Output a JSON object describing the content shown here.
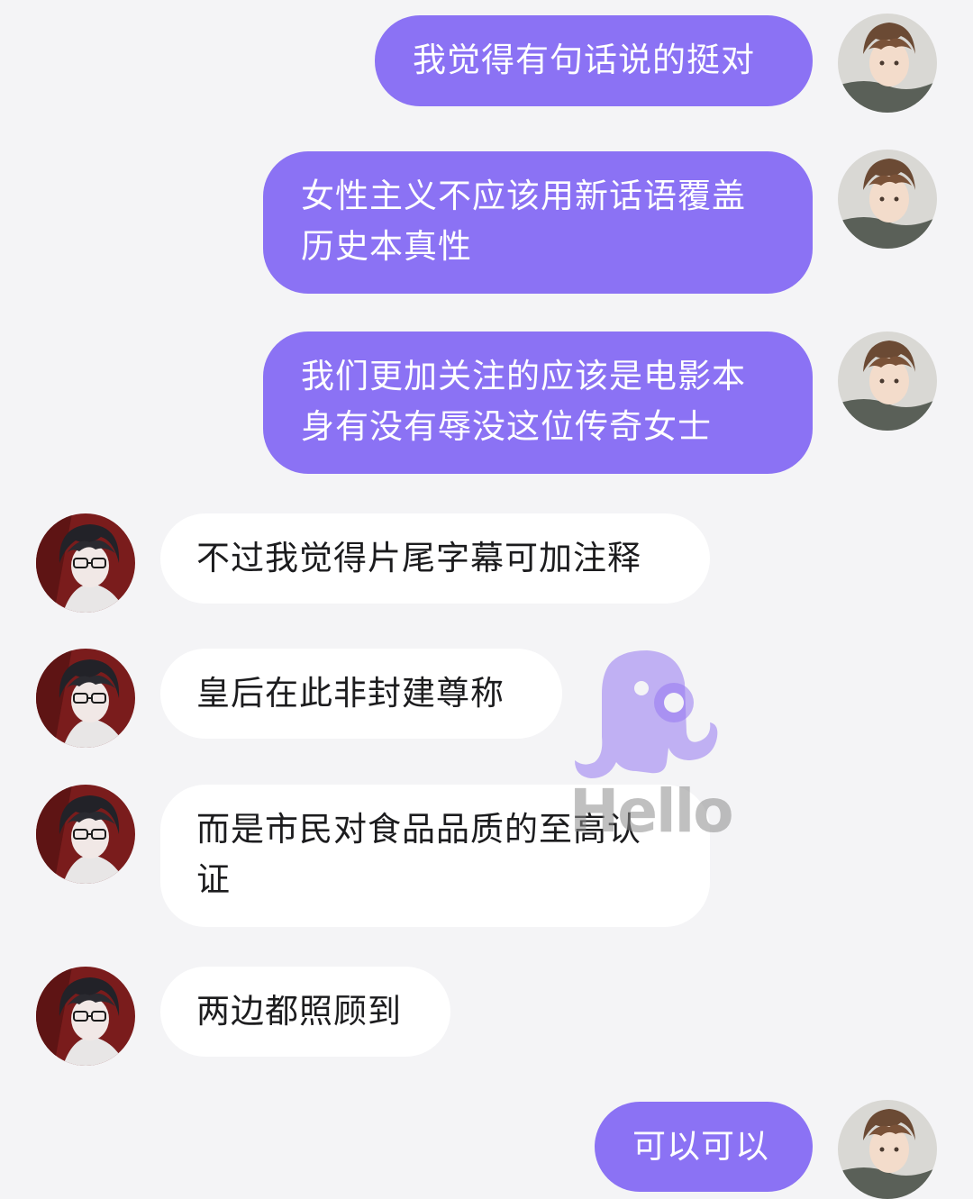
{
  "messages": [
    {
      "side": "out",
      "text": "我觉得有句话说的挺对"
    },
    {
      "side": "out",
      "text": "女性主义不应该用新话语覆盖历史本真性"
    },
    {
      "side": "out",
      "text": "我们更加关注的应该是电影本身有没有辱没这位传奇女士"
    },
    {
      "side": "in",
      "text": "不过我觉得片尾字幕可加注释"
    },
    {
      "side": "in",
      "text": "皇后在此非封建尊称"
    },
    {
      "side": "in",
      "text": "而是市民对食品品质的至高认证"
    },
    {
      "side": "in",
      "text": "两边都照顾到"
    },
    {
      "side": "out",
      "text": "可以可以"
    }
  ],
  "watermark": {
    "text": "Hello",
    "icon": "octopus-icon"
  },
  "colors": {
    "background": "#f4f4f6",
    "outgoing_bubble": "#8b72f4",
    "incoming_bubble": "#ffffff",
    "outgoing_text": "#ffffff",
    "incoming_text": "#1c1c1e"
  }
}
